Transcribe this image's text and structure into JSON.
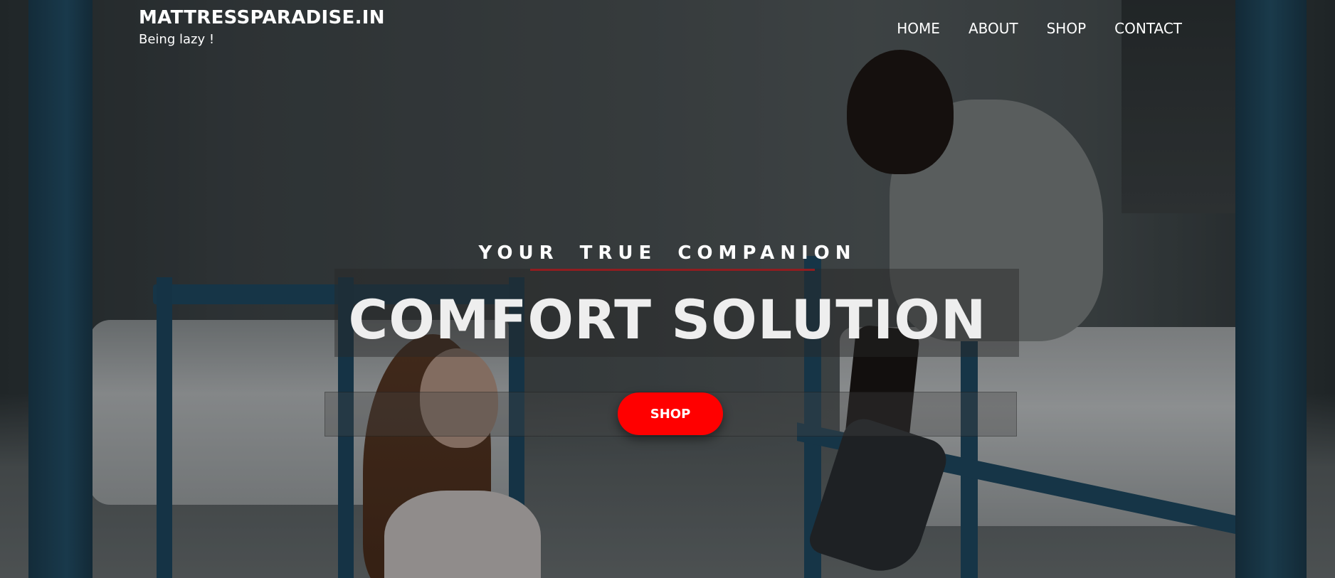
{
  "brand": {
    "title": "MATTRESSPARADISE.IN",
    "tagline": "Being lazy !"
  },
  "nav": {
    "items": [
      {
        "label": "HOME"
      },
      {
        "label": "ABOUT"
      },
      {
        "label": "SHOP"
      },
      {
        "label": "CONTACT"
      }
    ]
  },
  "hero": {
    "kicker": "YOUR TRUE COMPANION",
    "title": "COMFORT SOLUTION",
    "cta_label": "SHOP",
    "background_image": "two-people-on-bunk-beds-photo"
  },
  "colors": {
    "accent": "#ff0000",
    "underline": "#e5141b",
    "text": "#ffffff"
  }
}
